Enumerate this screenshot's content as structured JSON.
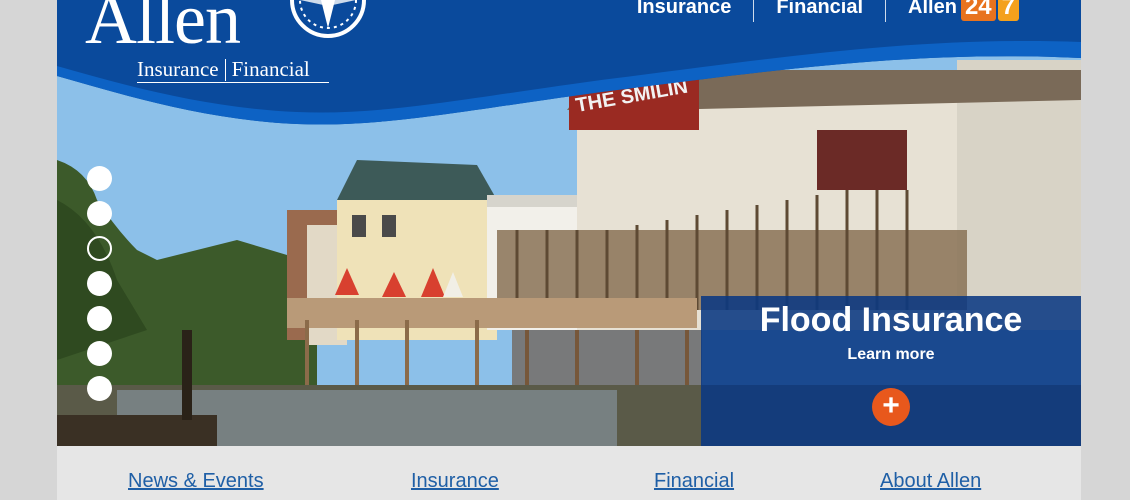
{
  "brand": {
    "name": "Allen",
    "sub_left": "Insurance",
    "sub_right": "Financial"
  },
  "top_nav": {
    "items": [
      "Insurance",
      "Financial",
      "Allen"
    ],
    "badge_24": "24",
    "badge_7": "7"
  },
  "hero": {
    "sign_text": "THE SMILIN",
    "slides_total": 7,
    "active_slide": 3
  },
  "promo": {
    "title": "Flood Insurance",
    "link": "Learn more",
    "plus": "+"
  },
  "bottom_nav": {
    "items": [
      "News & Events",
      "Insurance",
      "Financial",
      "About Allen"
    ]
  },
  "colors": {
    "brand_blue": "#0a4a9c",
    "accent_orange": "#e8581c",
    "link_blue": "#1f5fa6"
  }
}
